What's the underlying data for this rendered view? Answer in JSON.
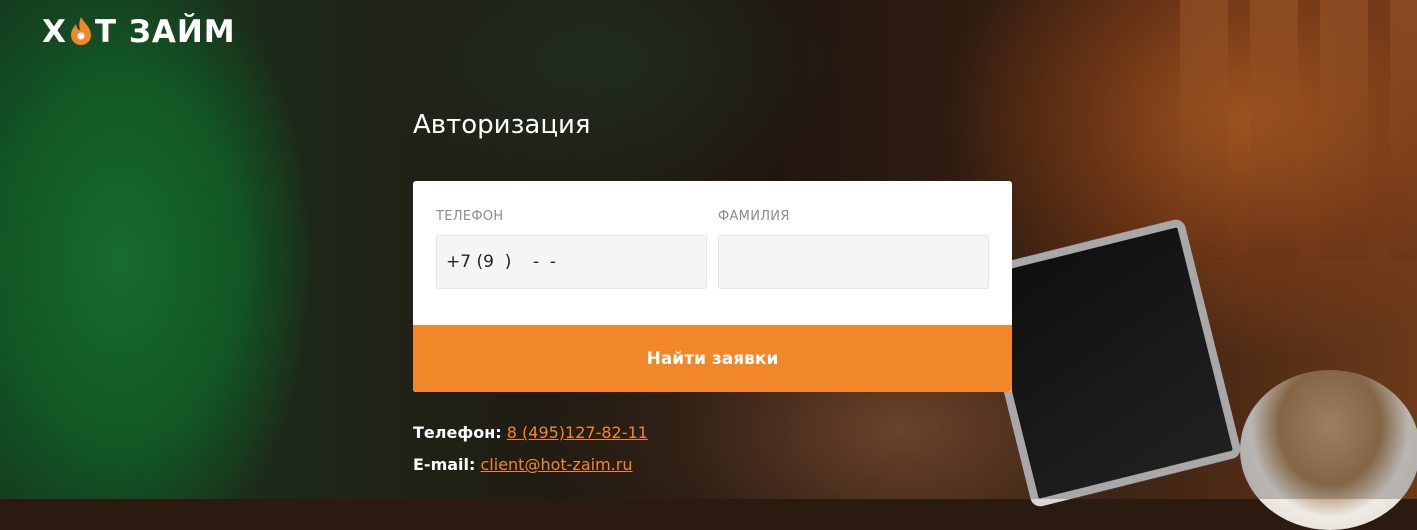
{
  "brand": {
    "logo_left": "Х",
    "logo_right": "Т ЗАЙМ",
    "accent": "#f2872a"
  },
  "auth": {
    "title": "Авторизация",
    "phone": {
      "label": "Телефон",
      "value": "+7 (9  )    -  -"
    },
    "surname": {
      "label": "Фамилия",
      "value": ""
    },
    "submit_label": "Найти заявки"
  },
  "contacts": {
    "phone_label": "Телефон:",
    "phone_value": "8 (495)127-82-11",
    "email_label": "E-mail:",
    "email_value": "client@hot-zaim.ru"
  },
  "icons": {
    "logo_flame": "flame-icon"
  }
}
